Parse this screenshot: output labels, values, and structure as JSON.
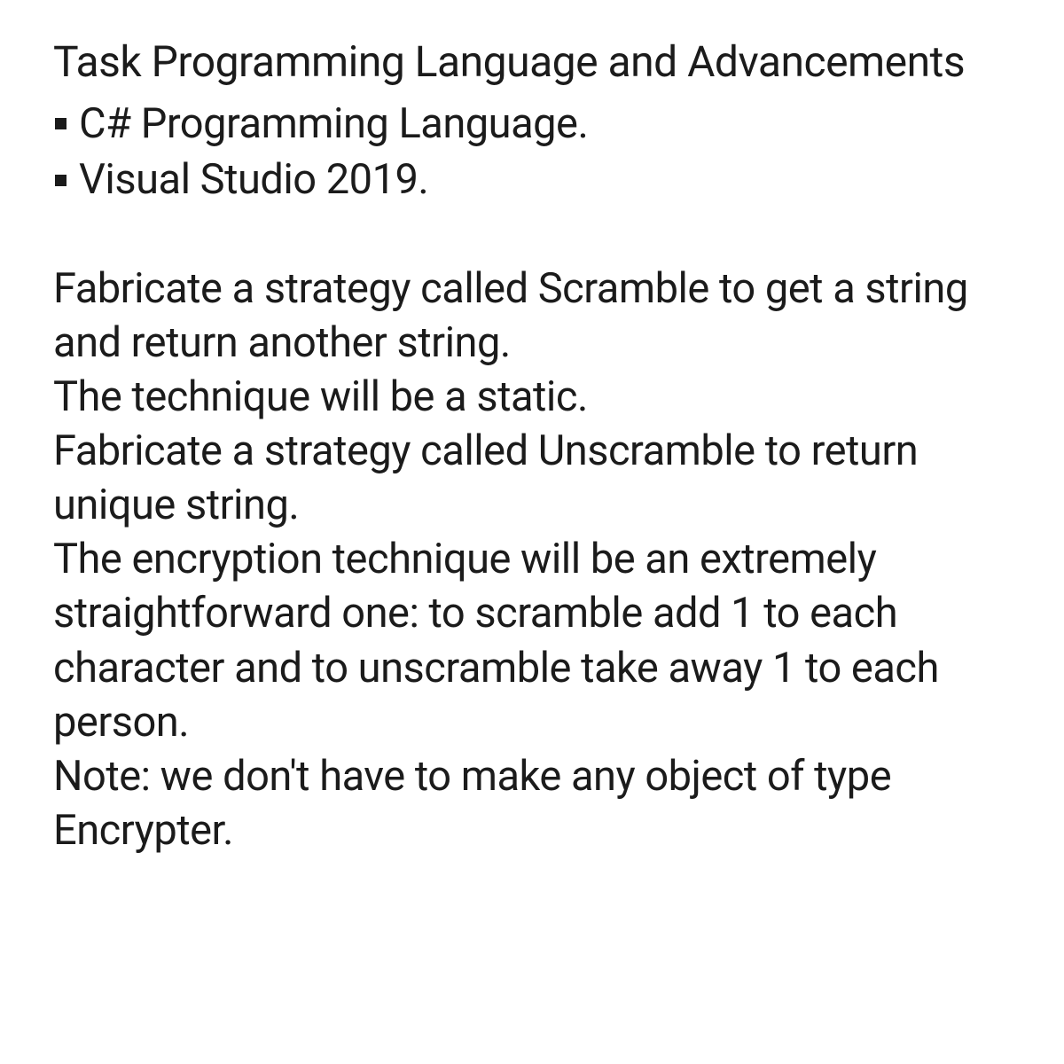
{
  "heading": "Task Programming Language and Advancements",
  "bullets": [
    "C# Programming Language.",
    "Visual Studio 2019."
  ],
  "body": [
    "Fabricate a strategy called Scramble to get a string and return another string.",
    "The technique will be a static.",
    "Fabricate a strategy called Unscramble to return unique string.",
    "The encryption technique will be an extremely straightforward one: to scramble add 1 to each",
    "character and to unscramble take away 1 to each person.",
    "Note: we don't have to make any object of type Encrypter."
  ]
}
